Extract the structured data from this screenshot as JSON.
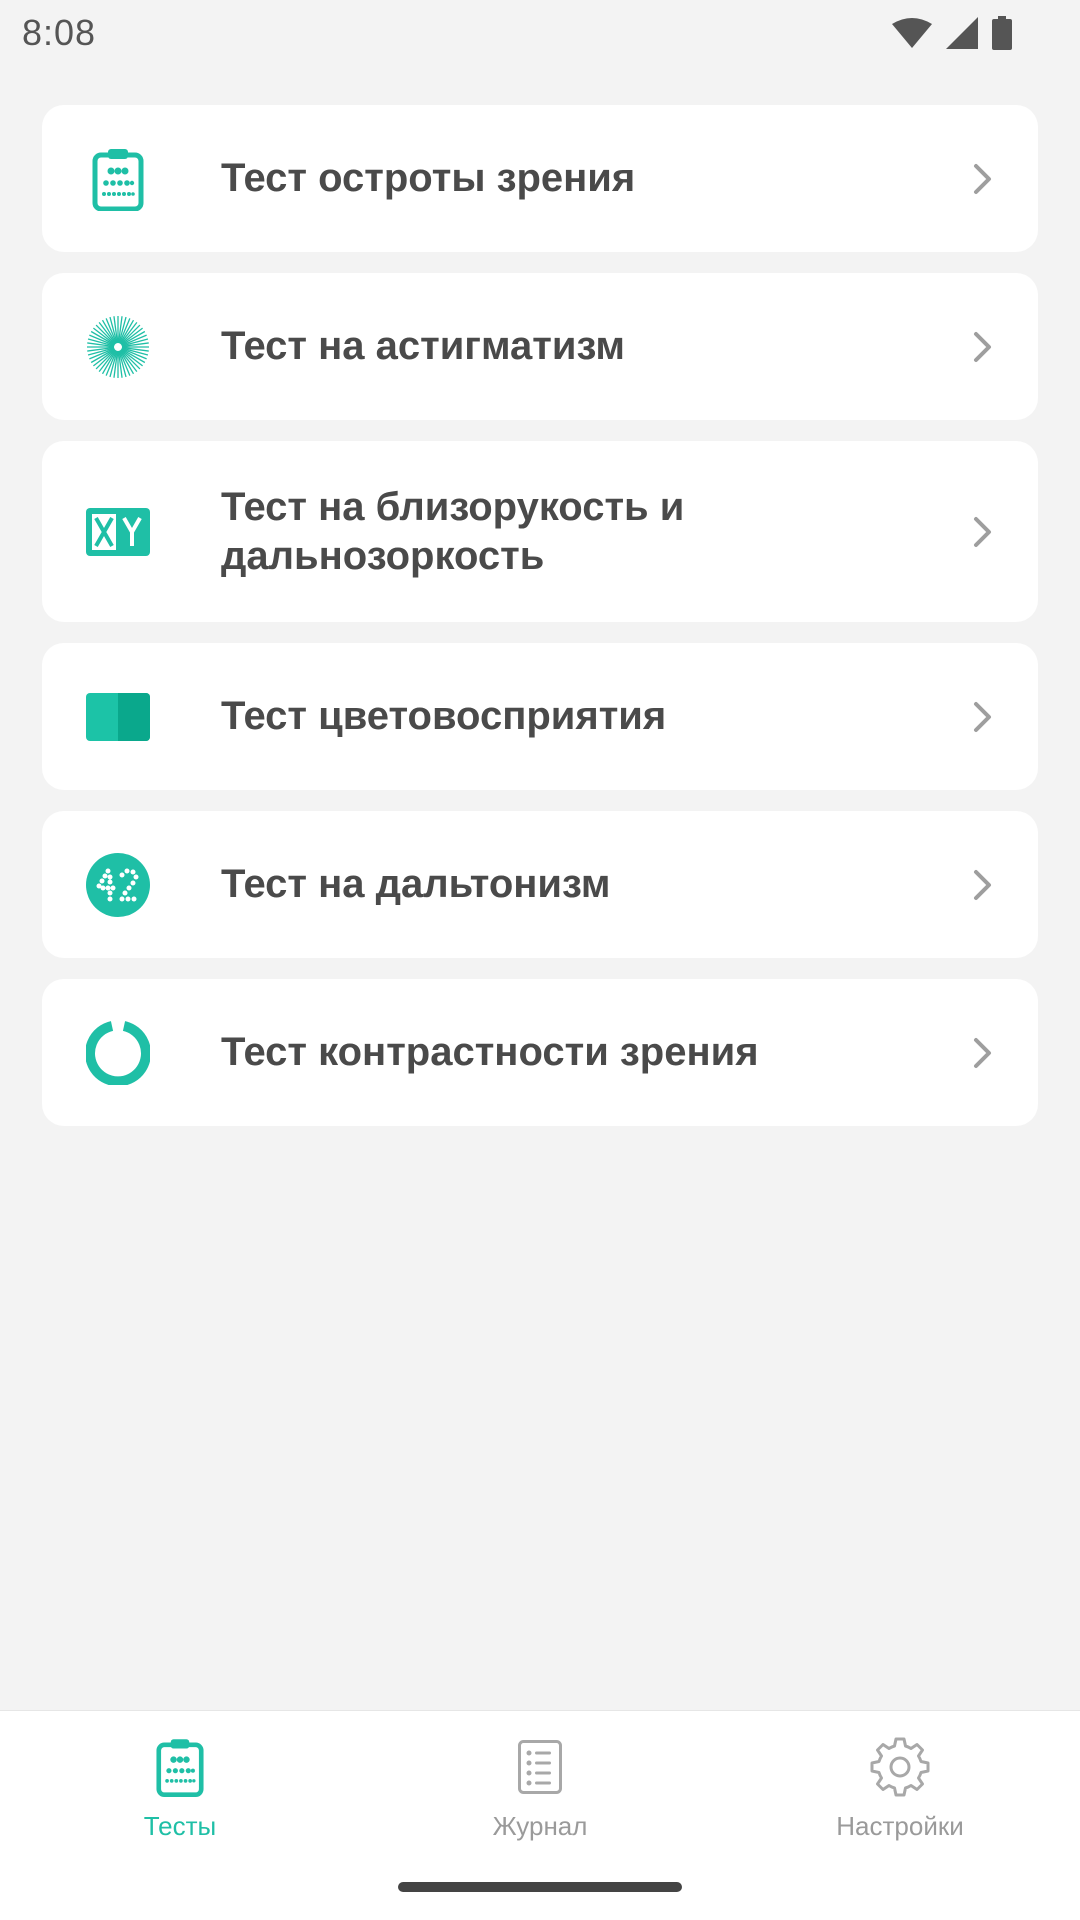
{
  "status_bar": {
    "time": "8:08"
  },
  "tests": [
    {
      "label": "Тест остроты зрения",
      "icon": "eye-chart-icon"
    },
    {
      "label": "Тест на астигматизм",
      "icon": "starburst-icon"
    },
    {
      "label": "Тест на близорукость и дальнозоркость",
      "icon": "xy-icon"
    },
    {
      "label": "Тест цветовосприятия",
      "icon": "color-square-icon"
    },
    {
      "label": "Тест на дальтонизм",
      "icon": "number-42-icon"
    },
    {
      "label": "Тест контрастности зрения",
      "icon": "ring-icon"
    }
  ],
  "nav": {
    "tests": "Тесты",
    "journal": "Журнал",
    "settings": "Настройки",
    "active": "tests"
  },
  "colors": {
    "accent": "#1fbfa6",
    "inactive": "#9a9a9a",
    "text": "#4a4a4a"
  }
}
